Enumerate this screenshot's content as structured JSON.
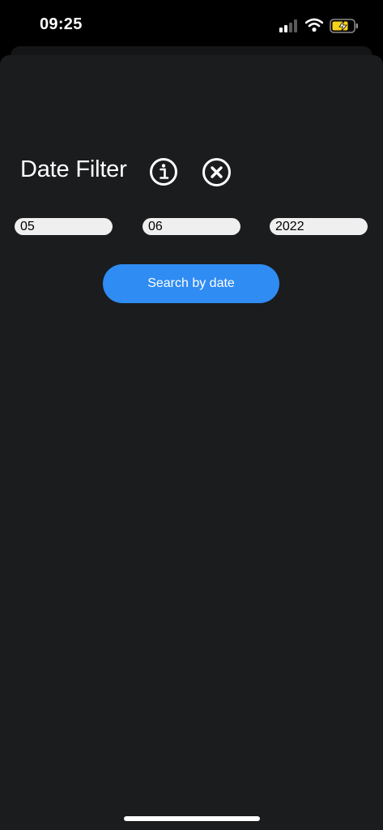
{
  "status_bar": {
    "time": "09:25",
    "signal_icon": "cellular-signal-icon",
    "wifi_icon": "wifi-icon",
    "battery_icon": "battery-charging-icon",
    "battery_color": "#f7d21b"
  },
  "header": {
    "title": "Date Filter",
    "info_icon": "info-circle-icon",
    "close_icon": "close-circle-icon"
  },
  "date_fields": {
    "day": "05",
    "month": "06",
    "year": "2022"
  },
  "search_button": {
    "label": "Search by date",
    "color": "#2f8cf3"
  },
  "colors": {
    "background": "#1b1c1e",
    "field": "#f0eff0"
  }
}
